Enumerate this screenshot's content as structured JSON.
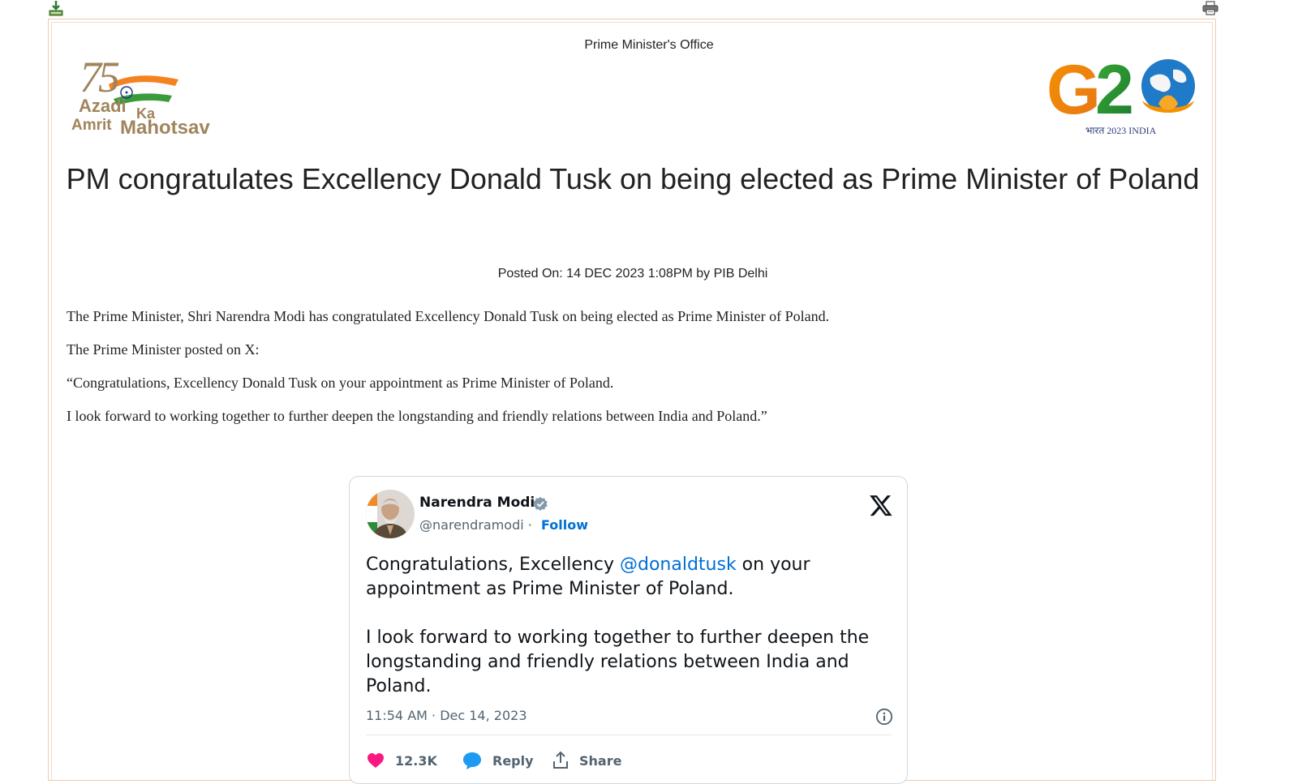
{
  "toolbar": {
    "download_icon": "download-icon",
    "print_icon": "print-icon"
  },
  "header": {
    "ministry": "Prime Minister's Office",
    "left_logo": {
      "numeral": "75",
      "line1": "Azadi",
      "line1b": "Ka",
      "line2": "Amrit",
      "line3": "Mahotsav"
    },
    "right_logo": {
      "text": "G20",
      "sub": "भारत 2023 INDIA"
    }
  },
  "article": {
    "title": "PM congratulates Excellency Donald Tusk on being elected as Prime Minister of Poland",
    "posted": "Posted On: 14 DEC 2023 1:08PM by PIB Delhi",
    "paragraphs": [
      "The Prime Minister, Shri Narendra Modi has congratulated Excellency Donald Tusk on being elected as Prime Minister of Poland.",
      "The Prime Minister posted on X:",
      "“Congratulations, Excellency Donald Tusk on your appointment as Prime Minister of Poland.",
      "I look forward to working together to further deepen the longstanding and friendly relations between India and Poland.”"
    ]
  },
  "tweet": {
    "author_name": "Narendra Modi",
    "handle": "@narendramodi",
    "separator": "·",
    "follow_label": "Follow",
    "text_part1": "Congratulations, Excellency ",
    "mention": "@donaldtusk",
    "text_part2": " on your appointment as Prime Minister of Poland.",
    "text_para2": "I look forward to working together to further deepen the longstanding and friendly relations between India and Poland.",
    "timestamp": "11:54 AM · Dec 14, 2023",
    "likes": "12.3K",
    "reply_label": "Reply",
    "share_label": "Share",
    "colors": {
      "link": "#006fd6",
      "like": "#f91880",
      "reply": "#1d9bf0"
    }
  }
}
